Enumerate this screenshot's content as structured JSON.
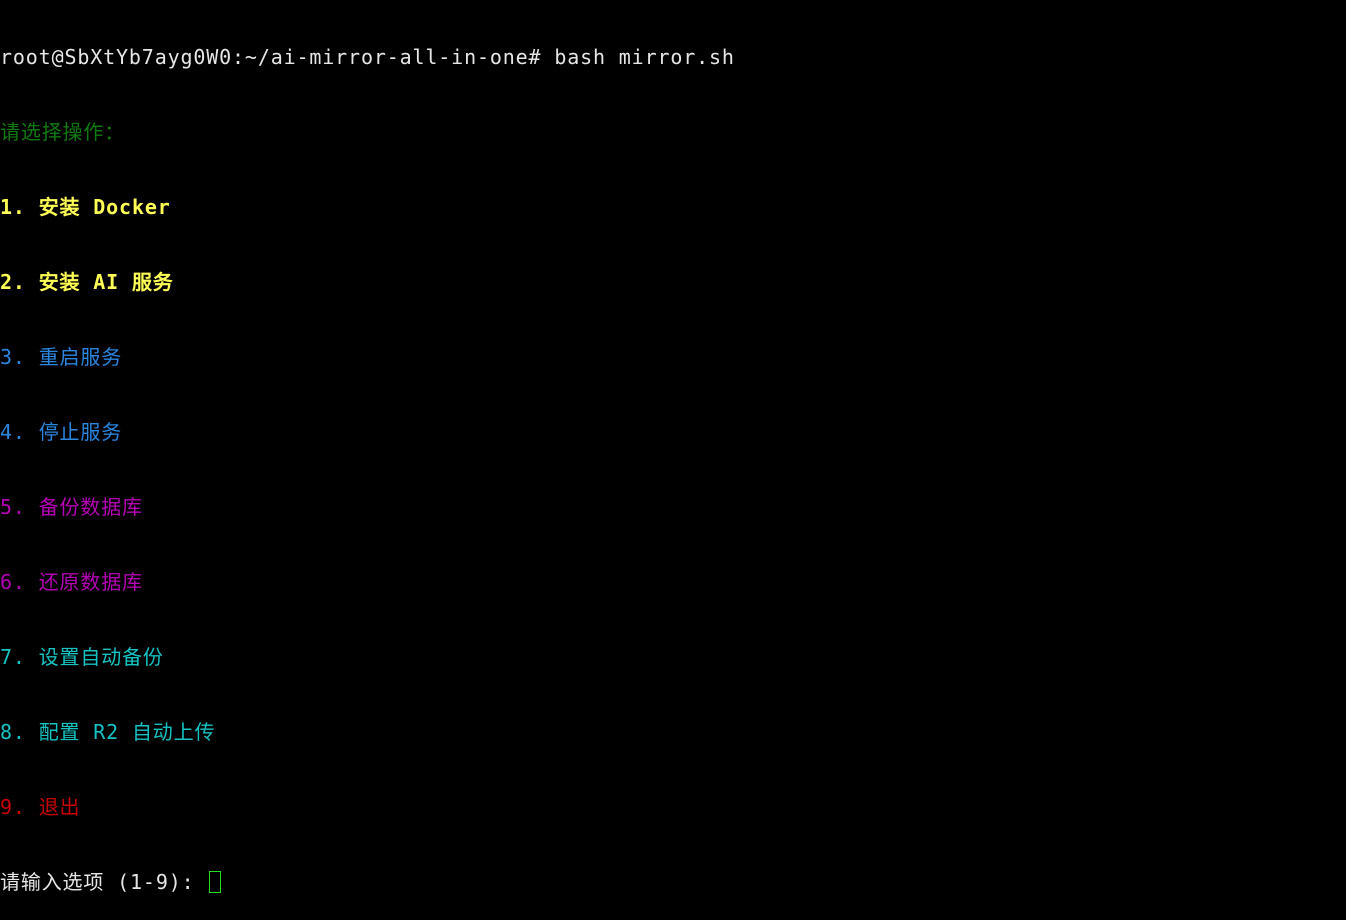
{
  "terminal": {
    "prompt": "root@SbXtYb7ayg0W0:~/ai-mirror-all-in-one# ",
    "command": "bash mirror.sh",
    "menu_title": "请选择操作：",
    "options": [
      {
        "number": "1. ",
        "label": "安装 Docker",
        "color": "#ffff55"
      },
      {
        "number": "2. ",
        "label": "安装 AI 服务",
        "color": "#ffff55"
      },
      {
        "number": "3. ",
        "label": "重启服务",
        "color": "#2b86e0"
      },
      {
        "number": "4. ",
        "label": "停止服务",
        "color": "#2b86e0"
      },
      {
        "number": "5. ",
        "label": "备份数据库",
        "color": "#b400b4"
      },
      {
        "number": "6. ",
        "label": "还原数据库",
        "color": "#b400b4"
      },
      {
        "number": "7. ",
        "label": "设置自动备份",
        "color": "#17c2c2"
      },
      {
        "number": "8. ",
        "label": "配置 R2 自动上传",
        "color": "#17c2c2"
      },
      {
        "number": "9. ",
        "label": "退出",
        "color": "#c80000"
      }
    ],
    "input_prompt": "请输入选项 (1-9): ",
    "input_value": ""
  }
}
